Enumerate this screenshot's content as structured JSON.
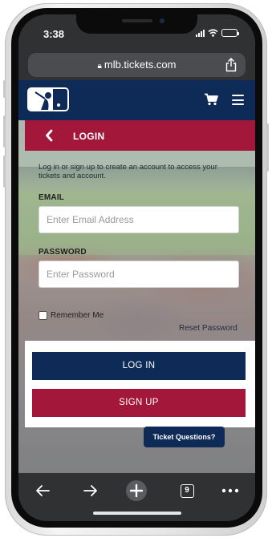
{
  "status_bar": {
    "time": "3:38"
  },
  "browser": {
    "url": "mlb.tickets.com"
  },
  "header": {
    "logo": "mlb-logo",
    "cart_icon": "cart-icon",
    "menu_icon": "hamburger-menu-icon"
  },
  "login_header": {
    "title": "LOGIN"
  },
  "form": {
    "intro": "Log in or sign up to create an account to access your tickets and account.",
    "email_label": "EMAIL",
    "email_placeholder": "Enter Email Address",
    "email_value": "",
    "password_label": "PASSWORD",
    "password_placeholder": "Enter Password",
    "password_value": "",
    "remember_me_label": "Remember Me",
    "remember_me_checked": false,
    "reset_password_label": "Reset Password"
  },
  "actions": {
    "login_label": "LOG IN",
    "signup_label": "SIGN UP"
  },
  "help": {
    "label": "Ticket Questions?"
  },
  "toolbar": {
    "tab_count": "9"
  },
  "colors": {
    "navy": "#0e2b57",
    "red": "#a3173a"
  }
}
